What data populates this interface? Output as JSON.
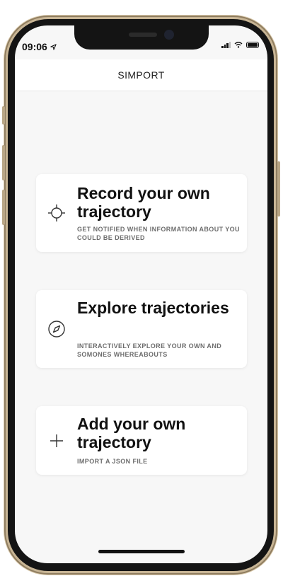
{
  "status_bar": {
    "time": "09:06"
  },
  "header": {
    "title": "SIMPORT"
  },
  "cards": [
    {
      "title": "Record your own trajectory",
      "subtitle": "GET NOTIFIED WHEN INFORMATION ABOUT YOU COULD BE DERIVED",
      "icon": "crosshair-icon"
    },
    {
      "title": "Explore trajectories",
      "subtitle": "INTERACTIVELY EXPLORE YOUR OWN AND SOMONES WHEREABOUTS",
      "icon": "compass-icon"
    },
    {
      "title": "Add your own trajectory",
      "subtitle": "IMPORT A JSON FILE",
      "icon": "plus-icon"
    }
  ],
  "colors": {
    "background": "#f7f7f7",
    "card": "#ffffff",
    "text": "#111111",
    "subtext": "#6d6d6d",
    "frame": "#c8b595"
  }
}
